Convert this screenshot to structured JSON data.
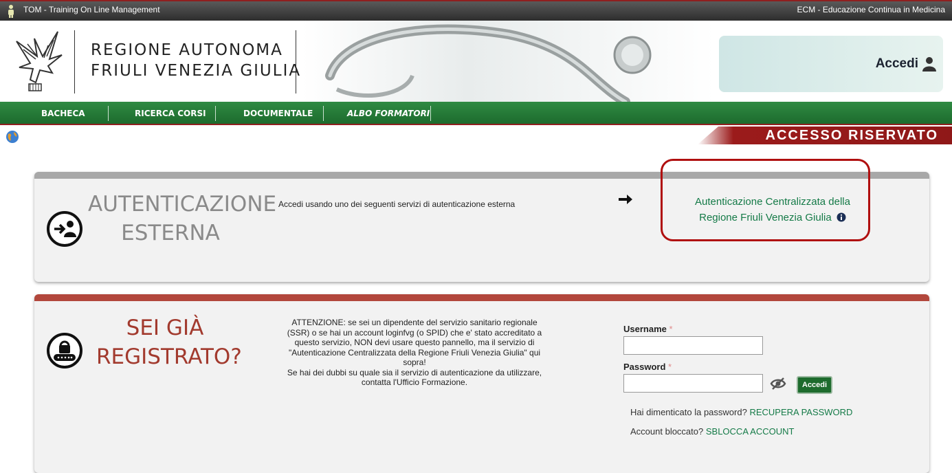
{
  "topbar": {
    "left_text": "TOM - Training On Line Management",
    "right_text": "ECM - Educazione Continua in Medicina"
  },
  "header": {
    "logo_line1": "REGIONE AUTONOMA",
    "logo_line2": "FRIULI VENEZIA GIULIA",
    "login_label": "Accedi"
  },
  "nav": {
    "items": [
      {
        "label": "BACHECA"
      },
      {
        "label": "RICERCA CORSI"
      },
      {
        "label": "DOCUMENTALE"
      },
      {
        "label": "ALBO FORMATORI"
      }
    ]
  },
  "ribbon": {
    "text": "ACCESSO RISERVATO"
  },
  "external_auth": {
    "title_line1": "AUTENTICAZIONE",
    "title_line2": "ESTERNA",
    "description": "Accedi usando uno dei seguenti servizi di autenticazione esterna",
    "link_line1": "Autenticazione Centralizzata della",
    "link_line2": "Regione Friuli Venezia Giulia"
  },
  "registered": {
    "title_line1": "SEI GIÀ",
    "title_line2": "REGISTRATO?",
    "warning_lines": [
      "ATTENZIONE: se sei un dipendente del servizio sanitario regionale",
      "(SSR) o se hai un account loginfvg (o SPID) che e' stato accreditato a",
      "questo servizio, NON devi usare questo pannello, ma il servizio di",
      "\"Autenticazione Centralizzata della Regione Friuli Venezia Giulia\" qui",
      "sopra!",
      "Se hai dei dubbi su quale sia il servizio di autenticazione da utilizzare,",
      "contatta l'Ufficio Formazione."
    ],
    "username_label": "Username",
    "password_label": "Password",
    "required_mark": "*",
    "username_value": "",
    "password_value": "",
    "submit_label": "Accedi",
    "forgot_text": "Hai dimenticato la password?",
    "forgot_link": "RECUPERA PASSWORD",
    "locked_text": "Account bloccato?",
    "locked_link": "SBLOCCA ACCOUNT"
  },
  "colors": {
    "nav_green": "#1d6b2d",
    "accent_red": "#8f1818",
    "link_green": "#147a47",
    "ext_title_gray": "#8a8a8a",
    "reg_title_red": "#a23a2e"
  }
}
